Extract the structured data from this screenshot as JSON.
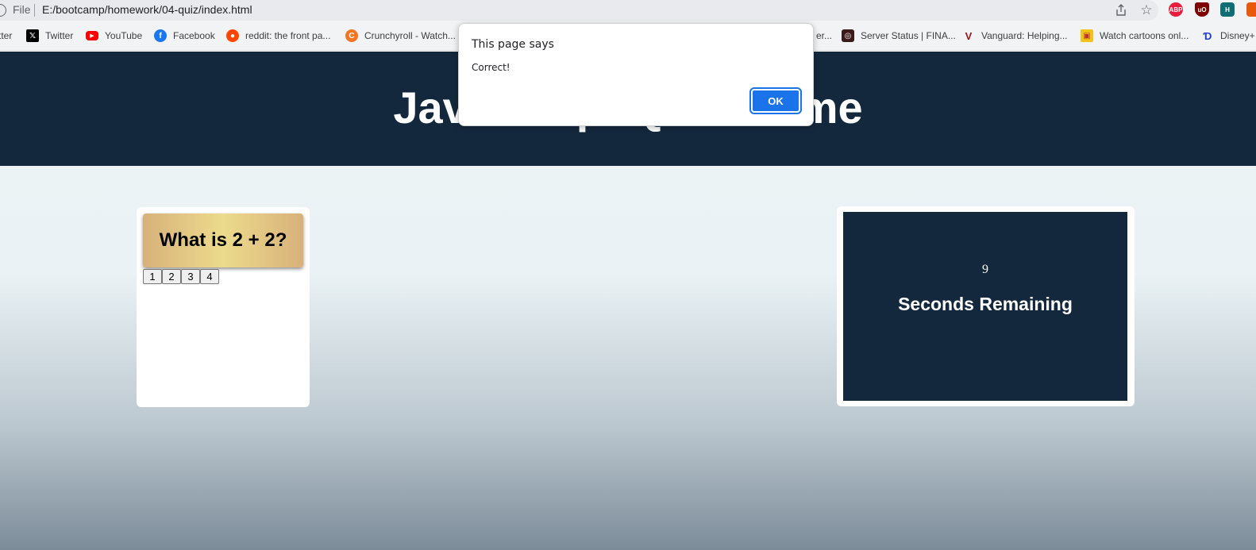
{
  "browser": {
    "file_label": "File",
    "url": "E:/bootcamp/homework/04-quiz/index.html",
    "extensions": [
      "ABP",
      "uO",
      "H",
      ""
    ],
    "bookmarks": [
      {
        "label": "tter",
        "icon": "twitter-icon"
      },
      {
        "label": "Twitter",
        "icon": "x-logo-icon"
      },
      {
        "label": "YouTube",
        "icon": "youtube-icon"
      },
      {
        "label": "Facebook",
        "icon": "facebook-icon"
      },
      {
        "label": "reddit: the front pa...",
        "icon": "reddit-icon"
      },
      {
        "label": "Crunchyroll - Watch...",
        "icon": "crunchyroll-icon"
      },
      {
        "label": "er...",
        "icon": ""
      },
      {
        "label": "Server Status | FINA...",
        "icon": "server-status-icon"
      },
      {
        "label": "Vanguard: Helping...",
        "icon": "vanguard-icon"
      },
      {
        "label": "Watch cartoons onl...",
        "icon": "cartoons-icon"
      },
      {
        "label": "Disney+",
        "icon": "disney-icon"
      }
    ]
  },
  "page": {
    "title": "JavaScript Quiz Game",
    "question": "What is 2 + 2?",
    "answers": [
      "1",
      "2",
      "3",
      "4"
    ],
    "timer": {
      "count": "9",
      "label": "Seconds Remaining"
    }
  },
  "alert": {
    "title": "This page says",
    "message": "Correct!",
    "ok_label": "OK"
  },
  "colors": {
    "header_bg": "#14283d",
    "accent": "#1a73e8",
    "question_gold": "#ecdb8c"
  }
}
